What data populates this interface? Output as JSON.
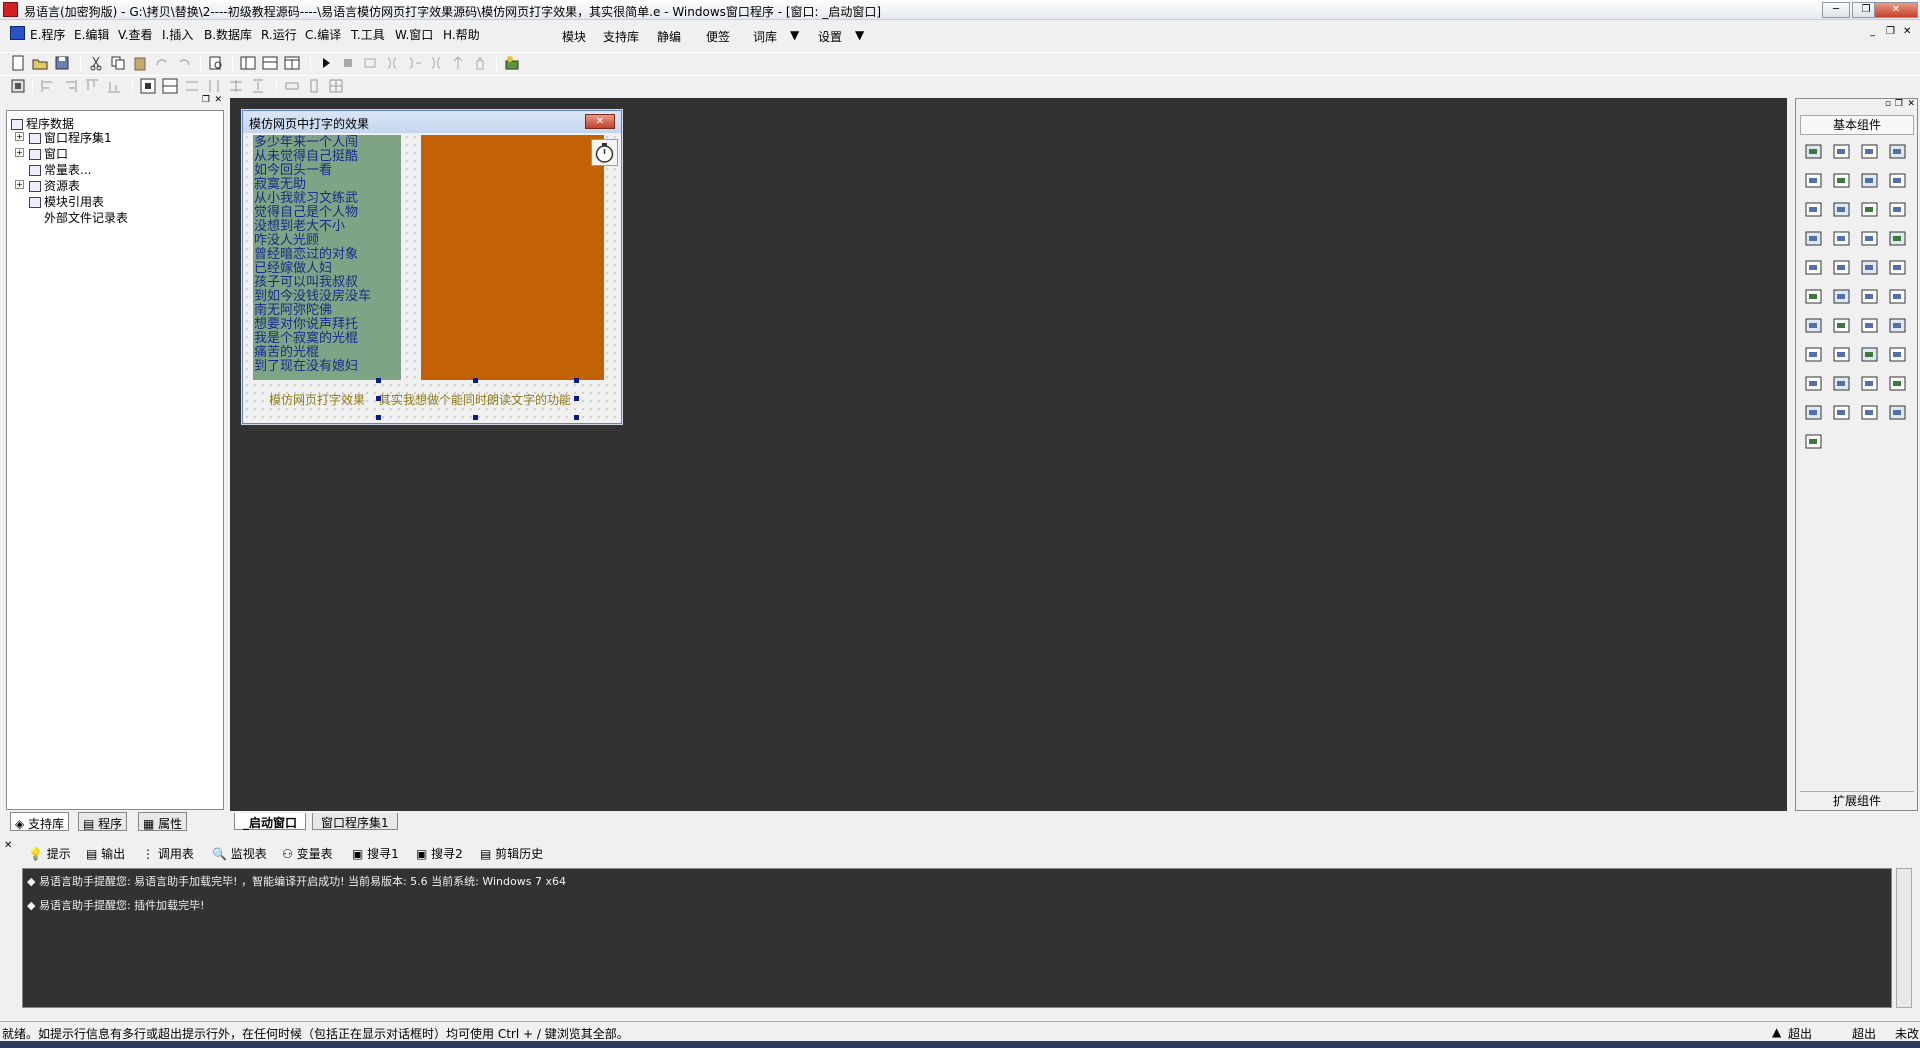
{
  "window": {
    "title": "易语言(加密狗版) - G:\\拷贝\\替换\\2----初级教程源码----\\易语言模仿网页打字效果源码\\模仿网页打字效果，其实很简单.e - Windows窗口程序 - [窗口: _启动窗口]",
    "min_label": "─",
    "max_label": "❐",
    "close_label": "✕"
  },
  "menu": {
    "items": [
      "E.程序",
      "E.编辑",
      "V.查看",
      "I.插入",
      "B.数据库",
      "R.运行",
      "C.编译",
      "T.工具",
      "W.窗口",
      "H.帮助"
    ],
    "right_items": [
      "模块",
      "支持库",
      "静编",
      "便签",
      "词库",
      "设置"
    ]
  },
  "tree": {
    "root": "程序数据",
    "items": [
      "窗口程序集1",
      "窗口",
      "常量表...",
      "资源表",
      "模块引用表",
      "外部文件记录表"
    ]
  },
  "left_tabs": [
    "支持库",
    "程序",
    "属性"
  ],
  "form": {
    "title": "模仿网页中打字的效果",
    "poem": [
      "多少年来一个人闯",
      "从未觉得自己挺酷",
      "如今回头一看",
      "寂寞无助",
      "从小我就习文练武",
      "觉得自己是个人物",
      "没想到老大不小",
      "咋没人光顾",
      "曾经暗恋过的对象",
      "已经嫁做人妇",
      "孩子可以叫我叔叔",
      "到如今没钱没房没车",
      "南无阿弥陀佛",
      "想要对你说声拜托",
      "我是个寂寞的光棍",
      "痛苦的光棍",
      "到了现在没有媳妇"
    ],
    "label1": "模仿网页打字效果",
    "label2": "其实我想做个能同时朗读文字的功能"
  },
  "components": {
    "header": "基本组件",
    "footer": "扩展组件"
  },
  "doc_tabs": [
    "_启动窗口",
    "窗口程序集1"
  ],
  "bottom_tabs": [
    "提示",
    "输出",
    "调用表",
    "监视表",
    "变量表",
    "搜寻1",
    "搜寻2",
    "剪辑历史"
  ],
  "output": [
    "◆ 易语言助手提醒您: 易语言助手加载完毕! ，智能编译开启成功! 当前易版本: 5.6 当前系统: Windows 7 x64",
    "◆ 易语言助手提醒您: 插件加载完毕!"
  ],
  "status": {
    "text": "就绪。如提示行信息有多行或超出提示行外，在任何时候（包括正在显示对话框时）均可使用 Ctrl + / 键浏览其全部。",
    "right1": "超出",
    "right2": "超出",
    "right3": "未改"
  },
  "colors": {
    "poem_bg": "#7fa385",
    "orange_box": "#c36106",
    "designer_bg": "#323232"
  }
}
